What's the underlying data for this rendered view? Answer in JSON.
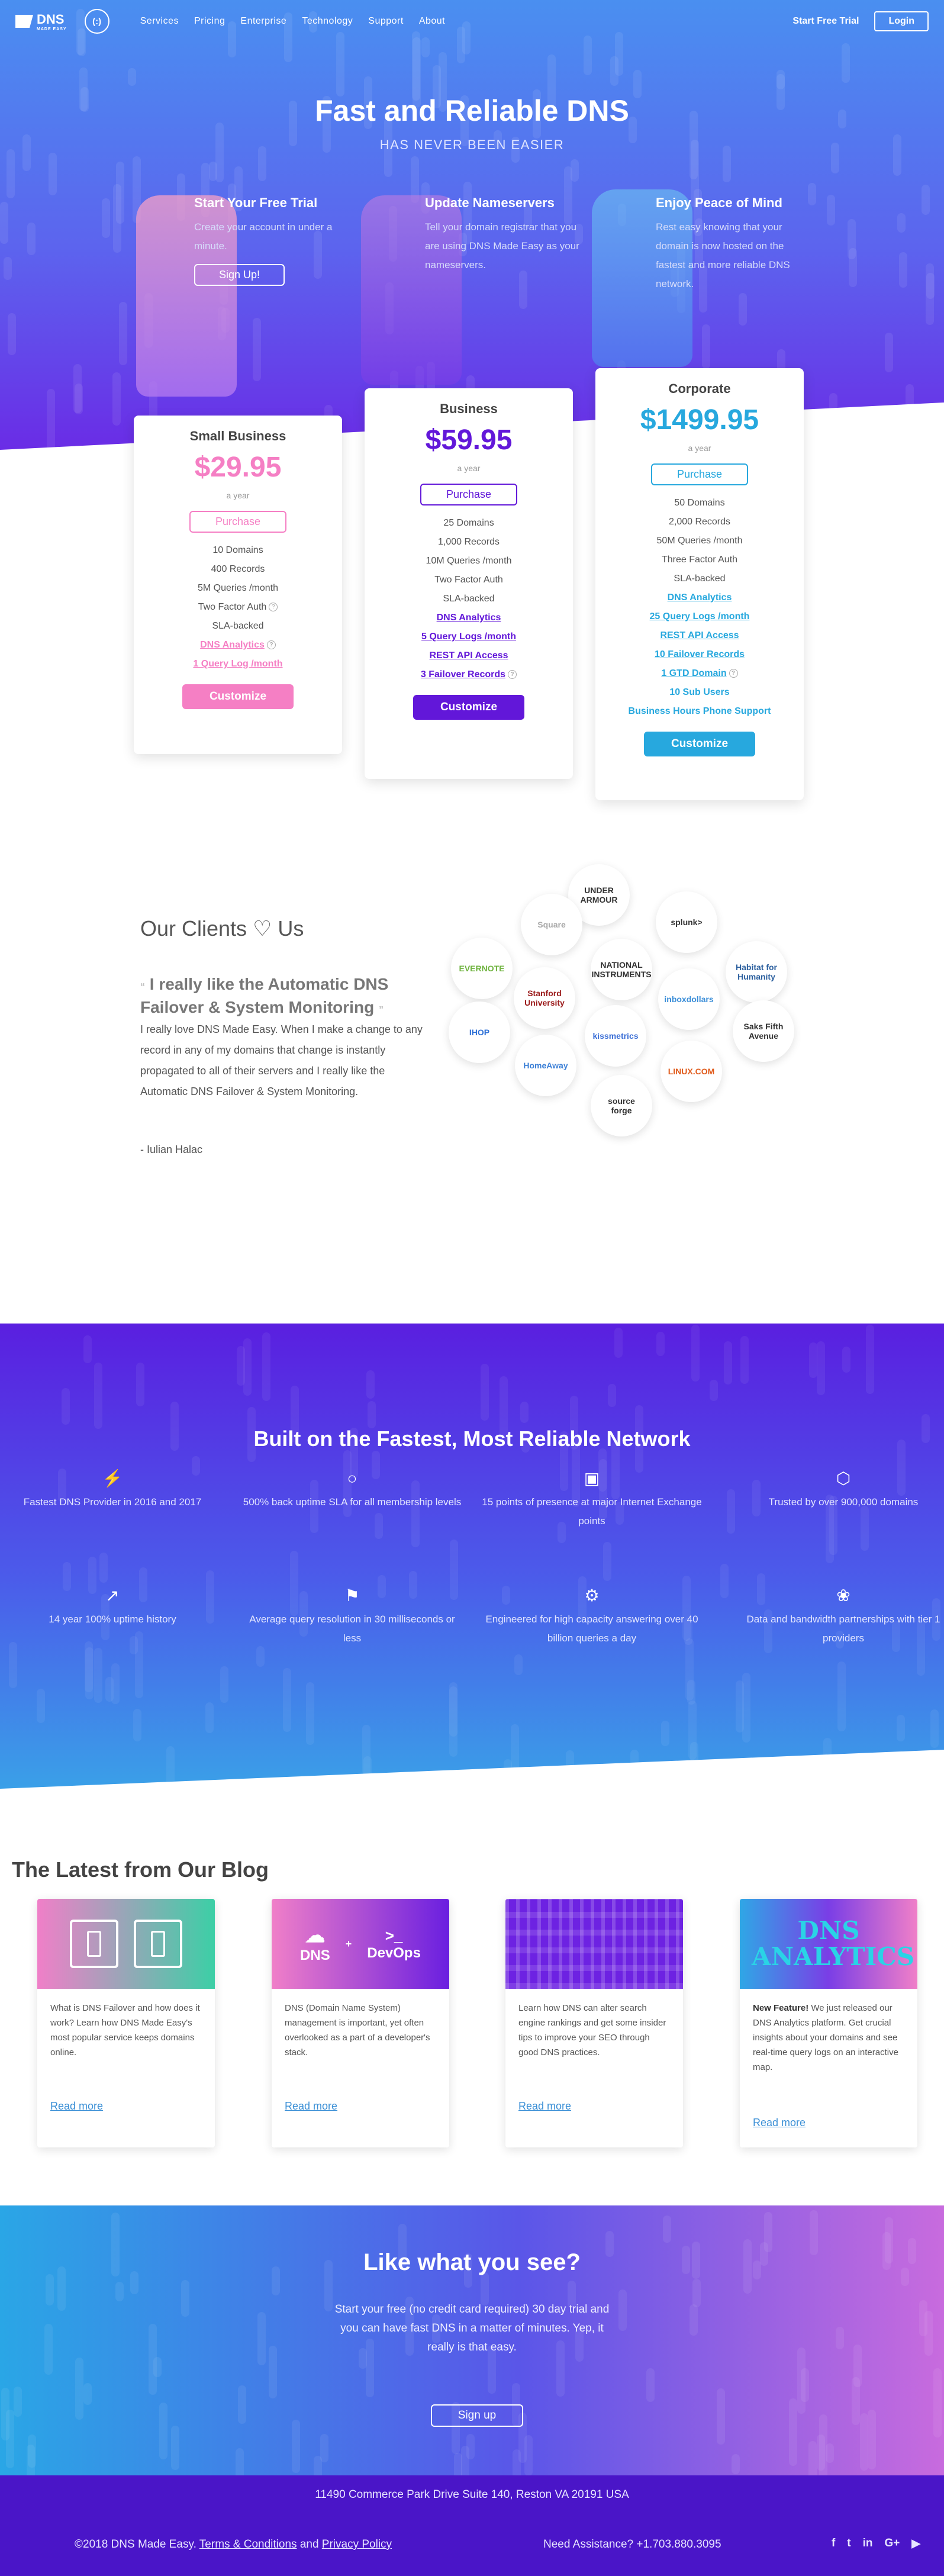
{
  "nav": {
    "logo_text": "DNS",
    "logo_sub": "MADE EASY",
    "badge": "(:)",
    "links": [
      "Services",
      "Pricing",
      "Enterprise",
      "Technology",
      "Support",
      "About"
    ],
    "trial": "Start Free Trial",
    "login": "Login"
  },
  "hero": {
    "title": "Fast and Reliable DNS",
    "subtitle": "HAS NEVER BEEN EASIER",
    "steps": [
      {
        "title": "Start Your Free Trial",
        "text": "Create your account in under a minute.",
        "button": "Sign Up!"
      },
      {
        "title": "Update Nameservers",
        "text": "Tell your domain registrar that you are using DNS Made Easy as your nameservers."
      },
      {
        "title": "Enjoy Peace of Mind",
        "text": "Rest easy knowing that your domain is now hosted on the fastest and more reliable DNS network."
      }
    ]
  },
  "plans": [
    {
      "name": "Small Business",
      "price": "$29.95",
      "period": "a year",
      "purchase": "Purchase",
      "customize": "Customize",
      "color": "#f57fc4",
      "features": [
        "10 Domains",
        "400 Records",
        "5M Queries /month",
        "Two Factor Auth",
        "SLA-backed",
        "DNS Analytics",
        "1 Query Log /month"
      ]
    },
    {
      "name": "Business",
      "price": "$59.95",
      "period": "a year",
      "purchase": "Purchase",
      "customize": "Customize",
      "color": "#6217d9",
      "features": [
        "25 Domains",
        "1,000 Records",
        "10M Queries /month",
        "Two Factor Auth",
        "SLA-backed",
        "DNS Analytics",
        "5 Query Logs /month",
        "REST API Access",
        "3 Failover Records"
      ]
    },
    {
      "name": "Corporate",
      "price": "$1499.95",
      "period": "a year",
      "purchase": "Purchase",
      "customize": "Customize",
      "color": "#27a8de",
      "features": [
        "50 Domains",
        "2,000 Records",
        "50M Queries /month",
        "Three Factor Auth",
        "SLA-backed",
        "DNS Analytics",
        "25 Query Logs /month",
        "REST API Access",
        "10 Failover Records",
        "1 GTD Domain",
        "10 Sub Users",
        "Business Hours Phone Support"
      ]
    }
  ],
  "clients": {
    "heading": "Our Clients ♡ Us",
    "quote_title": "I really like the Automatic DNS Failover & System Monitoring",
    "quote_text": "I really love DNS Made Easy. When I make a change to any record in any of my domains that change is instantly propagated to all of their servers and I really like the Automatic DNS Failover & System Monitoring.",
    "author": "- Iulian Halac",
    "logos": [
      "UNDER ARMOUR",
      "Square",
      "splunk>",
      "EVERNOTE",
      "NATIONAL INSTRUMENTS",
      "Habitat for Humanity",
      "Stanford University",
      "inboxdollars",
      "Saks Fifth Avenue",
      "IHOP",
      "kissmetrics",
      "HomeAway",
      "LINUX.COM",
      "source forge"
    ]
  },
  "network": {
    "heading": "Built on the Fastest, Most Reliable Network",
    "features": [
      {
        "icon": "⚡",
        "text": "Fastest DNS Provider in 2016 and 2017"
      },
      {
        "icon": "○",
        "text": "500% back uptime SLA for all membership levels"
      },
      {
        "icon": "▣",
        "text": "15 points of presence at major Internet Exchange points"
      },
      {
        "icon": "⬡",
        "text": "Trusted by over 900,000 domains"
      },
      {
        "icon": "↗",
        "text": "14 year 100% uptime history"
      },
      {
        "icon": "⚑",
        "text": "Average query resolution in 30 milliseconds or less"
      },
      {
        "icon": "⚙",
        "text": "Engineered for high capacity answering over 40 billion queries a day"
      },
      {
        "icon": "❀",
        "text": "Data and bandwidth partnerships with tier 1 providers"
      }
    ]
  },
  "blog": {
    "heading": "The Latest from Our Blog",
    "posts": [
      {
        "text": "What is DNS Failover and how does it work? Learn how DNS Made Easy's most popular service keeps domains online.",
        "more": "Read more"
      },
      {
        "text": "DNS (Domain Name System) management is important, yet often overlooked as a part of a developer's stack.",
        "more": "Read more",
        "img1": "DNS",
        "img2": "DevOps"
      },
      {
        "text": "Learn how DNS can alter search engine rankings and get some insider tips to improve your SEO through good DNS practices.",
        "more": "Read more"
      },
      {
        "lead": "New Feature!",
        "text": " We just released our DNS Analytics platform. Get crucial insights about your domains and see real-time query logs on an interactive map.",
        "more": "Read more",
        "img": "DNS ANALYTICS"
      }
    ]
  },
  "cta": {
    "heading": "Like what you see?",
    "text": "Start your free (no credit card required) 30 day trial and you can have fast DNS in a matter of minutes. Yep, it really is that easy.",
    "button": "Sign up"
  },
  "footer": {
    "address": "11490 Commerce Park Drive Suite 140, Reston VA 20191 USA",
    "copyright": "©2018 DNS Made Easy.",
    "terms": "Terms & Conditions",
    "and": "and",
    "privacy": "Privacy Policy",
    "assist": "Need Assistance?  +1.703.880.3095",
    "social": [
      "f",
      "t",
      "in",
      "G+",
      "▶"
    ]
  }
}
